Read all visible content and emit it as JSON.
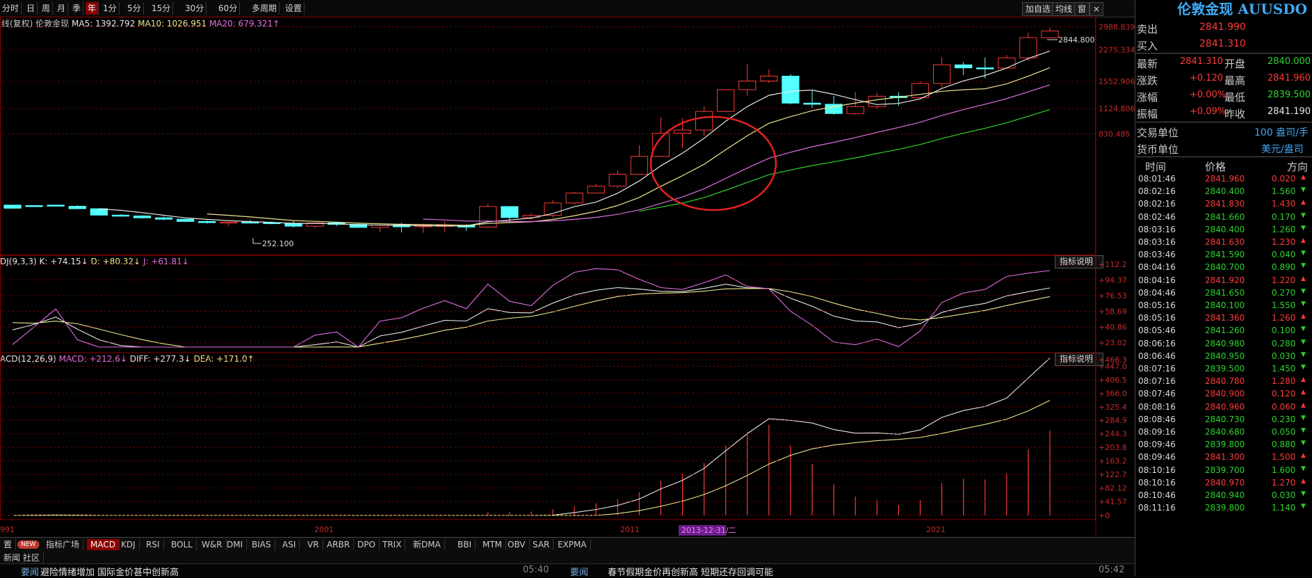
{
  "toolbar": {
    "periods": [
      "分时",
      "日",
      "周",
      "月",
      "季",
      "年",
      "1分",
      "5分",
      "15分",
      "30分",
      "60分",
      "多周期",
      "设置"
    ],
    "active_period": "年",
    "right_buttons": [
      "加自选",
      "均线",
      "窗",
      "×"
    ]
  },
  "main_chart": {
    "info_prefix": "线(复权) 伦敦金现",
    "ma5": "MA5: 1392.792",
    "ma10": "MA10: 1026.951",
    "ma20": "MA20: 679.321↑",
    "price_axis": [
      "2988.839",
      "2275.334",
      "1552.906",
      "1124.806",
      "830.485"
    ],
    "high_marker": "2844.800",
    "low_marker": "252.100",
    "candles": [
      {
        "open": 355,
        "close": 342,
        "high": 356,
        "low": 340
      },
      {
        "open": 353,
        "close": 349,
        "high": 354,
        "low": 347
      },
      {
        "open": 355,
        "close": 351,
        "high": 356,
        "low": 349
      },
      {
        "open": 350,
        "close": 340,
        "high": 354,
        "low": 338
      },
      {
        "open": 340,
        "close": 315,
        "high": 342,
        "low": 314
      },
      {
        "open": 315,
        "close": 312,
        "high": 318,
        "low": 309
      },
      {
        "open": 312,
        "close": 305,
        "high": 314,
        "low": 302
      },
      {
        "open": 305,
        "close": 300,
        "high": 310,
        "low": 296
      },
      {
        "open": 300,
        "close": 292,
        "high": 302,
        "low": 290
      },
      {
        "open": 292,
        "close": 288,
        "high": 296,
        "low": 285
      },
      {
        "open": 288,
        "close": 290,
        "high": 291,
        "low": 276
      },
      {
        "open": 290,
        "close": 288,
        "high": 298,
        "low": 285
      },
      {
        "open": 288,
        "close": 286,
        "high": 292,
        "low": 282
      },
      {
        "open": 286,
        "close": 276,
        "high": 294,
        "low": 272
      },
      {
        "open": 276,
        "close": 287,
        "high": 289,
        "low": 270
      },
      {
        "open": 287,
        "close": 282,
        "high": 291,
        "low": 276
      },
      {
        "open": 282,
        "close": 272,
        "high": 287,
        "low": 271
      },
      {
        "open": 272,
        "close": 280,
        "high": 283,
        "low": 257
      },
      {
        "open": 280,
        "close": 274,
        "high": 287,
        "low": 256
      },
      {
        "open": 274,
        "close": 279,
        "high": 284,
        "low": 255
      },
      {
        "open": 279,
        "close": 279,
        "high": 293,
        "low": 256
      },
      {
        "open": 279,
        "close": 273,
        "high": 282,
        "low": 261
      },
      {
        "open": 273,
        "close": 349,
        "high": 360,
        "low": 271
      },
      {
        "open": 349,
        "close": 306,
        "high": 348,
        "low": 290
      },
      {
        "open": 306,
        "close": 314,
        "high": 323,
        "low": 296
      },
      {
        "open": 314,
        "close": 364,
        "high": 376,
        "low": 305
      },
      {
        "open": 364,
        "close": 410,
        "high": 417,
        "low": 358
      },
      {
        "open": 410,
        "close": 445,
        "high": 458,
        "low": 414
      },
      {
        "open": 445,
        "close": 513,
        "high": 537,
        "low": 435
      },
      {
        "open": 513,
        "close": 635,
        "high": 726,
        "low": 542
      },
      {
        "open": 635,
        "close": 837,
        "high": 1011,
        "low": 681
      },
      {
        "open": 837,
        "close": 870,
        "high": 1003,
        "low": 704
      },
      {
        "open": 870,
        "close": 1087,
        "high": 1156,
        "low": 810
      },
      {
        "open": 1087,
        "close": 1409,
        "high": 1421,
        "low": 1078
      },
      {
        "open": 1409,
        "close": 1563,
        "high": 1920,
        "low": 1310
      },
      {
        "open": 1563,
        "close": 1657,
        "high": 1796,
        "low": 1527
      },
      {
        "open": 1657,
        "close": 1200,
        "high": 1694,
        "low": 1180
      },
      {
        "open": 1200,
        "close": 1184,
        "high": 1392,
        "low": 1131
      },
      {
        "open": 1184,
        "close": 1060,
        "high": 1307,
        "low": 1045
      },
      {
        "open": 1060,
        "close": 1151,
        "high": 1375,
        "low": 1046
      },
      {
        "open": 1151,
        "close": 1303,
        "high": 1357,
        "low": 1124
      },
      {
        "open": 1303,
        "close": 1282,
        "high": 1366,
        "low": 1160
      },
      {
        "open": 1282,
        "close": 1517,
        "high": 1557,
        "low": 1267
      },
      {
        "open": 1517,
        "close": 1896,
        "high": 2075,
        "low": 1451
      },
      {
        "open": 1896,
        "close": 1829,
        "high": 1959,
        "low": 1677
      },
      {
        "open": 1829,
        "close": 1824,
        "high": 2070,
        "low": 1614
      },
      {
        "open": 1824,
        "close": 2062,
        "high": 2135,
        "low": 1810
      },
      {
        "open": 2062,
        "close": 2624,
        "high": 2790,
        "low": 1984
      },
      {
        "open": 2624,
        "close": 2841,
        "high": 2956,
        "low": 2600
      }
    ],
    "annotation": "red circle around 2012-2015 candles"
  },
  "kdj": {
    "label": "DJ(9,3,3)",
    "k": "K: +74.15↓",
    "d": "D: +80.32↓",
    "j": "J: +61.81↓",
    "button": "指标说明",
    "axis": [
      "+112.2",
      "+94.37",
      "+76.53",
      "+58.69",
      "+40.86",
      "+23.02"
    ]
  },
  "macd": {
    "label": "ACD(12,26,9)",
    "macd": "MACD: +212.6↓",
    "diff": "DIFF: +277.3↓",
    "dea": "DEA: +171.0↑",
    "button": "指标说明",
    "axis": [
      "+466.3",
      "+447.0",
      "+406.5",
      "+366.0",
      "+325.4",
      "+284.9",
      "+244.3",
      "+203.8",
      "+163.2",
      "+122.7",
      "+82.12",
      "+41.57",
      "+0"
    ]
  },
  "time_axis": {
    "labels": [
      "991",
      "2001",
      "2011",
      "2021"
    ],
    "cursor_label": "2013-12-31/二"
  },
  "tabs": {
    "row1": [
      "置",
      "NEW",
      "指标广场",
      "MACD",
      "KDJ",
      "RSI",
      "BOLL",
      "W&R",
      "DMI",
      "BIAS",
      "ASI",
      "VR",
      "ARBR",
      "DPO",
      "TRIX",
      "新DMA",
      "BBI",
      "MTM",
      "OBV",
      "SAR",
      "EXPMA"
    ],
    "active": "MACD",
    "row2": [
      "新闻",
      "社区"
    ]
  },
  "news": {
    "item1_tag": "要闻",
    "item1_text": "避险情绪增加 国际金价甚中创新高",
    "item1_time": "05:40",
    "item2_tag": "要闻",
    "item2_text": "春节假期金价再创新高 短期还存回调可能",
    "item2_time": "05:42"
  },
  "quote_panel": {
    "title": "伦敦金现 AUUSDO",
    "sell_label": "卖出",
    "sell": "2841.990",
    "buy_label": "买入",
    "buy": "2841.310",
    "latest_label": "最新",
    "latest": "2841.310",
    "open_label": "开盘",
    "open": "2840.000",
    "change_label": "涨跌",
    "change": "+0.120",
    "high_label": "最高",
    "high": "2841.960",
    "pct_label": "涨幅",
    "pct": "+0.00%",
    "low_label": "最低",
    "low": "2839.500",
    "amp_label": "振幅",
    "amp": "+0.09%",
    "prev_label": "昨收",
    "prev": "2841.190",
    "unit_label": "交易单位",
    "unit": "100 盎司/手",
    "currency_label": "货币单位",
    "currency": "美元/盎司",
    "headers": [
      "时间",
      "价格",
      "方向"
    ],
    "trades": [
      {
        "time": "08:01:46",
        "price": "2841.960",
        "vol": "0.020",
        "dir": "up"
      },
      {
        "time": "08:02:16",
        "price": "2840.400",
        "vol": "1.560",
        "dir": "down"
      },
      {
        "time": "08:02:16",
        "price": "2841.830",
        "vol": "1.430",
        "dir": "up"
      },
      {
        "time": "08:02:46",
        "price": "2841.660",
        "vol": "0.170",
        "dir": "down"
      },
      {
        "time": "08:03:16",
        "price": "2840.400",
        "vol": "1.260",
        "dir": "down"
      },
      {
        "time": "08:03:16",
        "price": "2841.630",
        "vol": "1.230",
        "dir": "up"
      },
      {
        "time": "08:03:46",
        "price": "2841.590",
        "vol": "0.040",
        "dir": "down"
      },
      {
        "time": "08:04:16",
        "price": "2840.700",
        "vol": "0.890",
        "dir": "down"
      },
      {
        "time": "08:04:16",
        "price": "2841.920",
        "vol": "1.220",
        "dir": "up"
      },
      {
        "time": "08:04:46",
        "price": "2841.650",
        "vol": "0.270",
        "dir": "down"
      },
      {
        "time": "08:05:16",
        "price": "2840.100",
        "vol": "1.550",
        "dir": "down"
      },
      {
        "time": "08:05:16",
        "price": "2841.360",
        "vol": "1.260",
        "dir": "up"
      },
      {
        "time": "08:05:46",
        "price": "2841.260",
        "vol": "0.100",
        "dir": "down"
      },
      {
        "time": "08:06:16",
        "price": "2840.980",
        "vol": "0.280",
        "dir": "down"
      },
      {
        "time": "08:06:46",
        "price": "2840.950",
        "vol": "0.030",
        "dir": "down"
      },
      {
        "time": "08:07:16",
        "price": "2839.500",
        "vol": "1.450",
        "dir": "down"
      },
      {
        "time": "08:07:16",
        "price": "2840.780",
        "vol": "1.280",
        "dir": "up"
      },
      {
        "time": "08:07:46",
        "price": "2840.900",
        "vol": "0.120",
        "dir": "up"
      },
      {
        "time": "08:08:16",
        "price": "2840.960",
        "vol": "0.060",
        "dir": "up"
      },
      {
        "time": "08:08:46",
        "price": "2840.730",
        "vol": "0.230",
        "dir": "down"
      },
      {
        "time": "08:09:16",
        "price": "2840.680",
        "vol": "0.050",
        "dir": "down"
      },
      {
        "time": "08:09:46",
        "price": "2839.800",
        "vol": "0.880",
        "dir": "down"
      },
      {
        "time": "08:09:46",
        "price": "2841.300",
        "vol": "1.500",
        "dir": "up"
      },
      {
        "time": "08:10:16",
        "price": "2839.700",
        "vol": "1.600",
        "dir": "down"
      },
      {
        "time": "08:10:16",
        "price": "2840.970",
        "vol": "1.270",
        "dir": "up"
      },
      {
        "time": "08:10:46",
        "price": "2840.940",
        "vol": "0.030",
        "dir": "down"
      },
      {
        "time": "08:11:16",
        "price": "2839.800",
        "vol": "1.140",
        "dir": "down"
      }
    ]
  },
  "colors": {
    "up": "#ff3a3a",
    "down": "#54ffff",
    "bg": "#000000",
    "grid": "#8b0000",
    "ma5": "#e8e8e8",
    "ma10": "#f0e68c",
    "ma20": "#e070e0",
    "ma60": "#2bd42b",
    "accent": "#3fa9f5"
  }
}
